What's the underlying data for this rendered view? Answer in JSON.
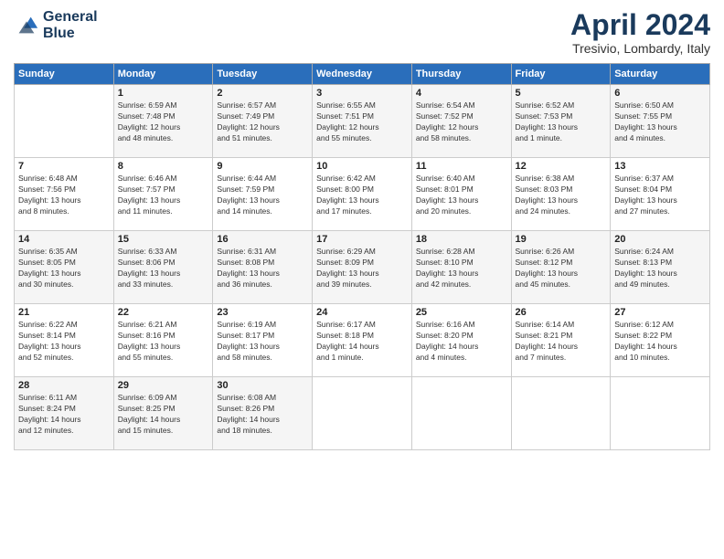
{
  "logo": {
    "line1": "General",
    "line2": "Blue"
  },
  "title": "April 2024",
  "subtitle": "Tresivio, Lombardy, Italy",
  "days_of_week": [
    "Sunday",
    "Monday",
    "Tuesday",
    "Wednesday",
    "Thursday",
    "Friday",
    "Saturday"
  ],
  "weeks": [
    [
      {
        "day": "",
        "sunrise": "",
        "sunset": "",
        "daylight": ""
      },
      {
        "day": "1",
        "sunrise": "Sunrise: 6:59 AM",
        "sunset": "Sunset: 7:48 PM",
        "daylight": "Daylight: 12 hours and 48 minutes."
      },
      {
        "day": "2",
        "sunrise": "Sunrise: 6:57 AM",
        "sunset": "Sunset: 7:49 PM",
        "daylight": "Daylight: 12 hours and 51 minutes."
      },
      {
        "day": "3",
        "sunrise": "Sunrise: 6:55 AM",
        "sunset": "Sunset: 7:51 PM",
        "daylight": "Daylight: 12 hours and 55 minutes."
      },
      {
        "day": "4",
        "sunrise": "Sunrise: 6:54 AM",
        "sunset": "Sunset: 7:52 PM",
        "daylight": "Daylight: 12 hours and 58 minutes."
      },
      {
        "day": "5",
        "sunrise": "Sunrise: 6:52 AM",
        "sunset": "Sunset: 7:53 PM",
        "daylight": "Daylight: 13 hours and 1 minute."
      },
      {
        "day": "6",
        "sunrise": "Sunrise: 6:50 AM",
        "sunset": "Sunset: 7:55 PM",
        "daylight": "Daylight: 13 hours and 4 minutes."
      }
    ],
    [
      {
        "day": "7",
        "sunrise": "Sunrise: 6:48 AM",
        "sunset": "Sunset: 7:56 PM",
        "daylight": "Daylight: 13 hours and 8 minutes."
      },
      {
        "day": "8",
        "sunrise": "Sunrise: 6:46 AM",
        "sunset": "Sunset: 7:57 PM",
        "daylight": "Daylight: 13 hours and 11 minutes."
      },
      {
        "day": "9",
        "sunrise": "Sunrise: 6:44 AM",
        "sunset": "Sunset: 7:59 PM",
        "daylight": "Daylight: 13 hours and 14 minutes."
      },
      {
        "day": "10",
        "sunrise": "Sunrise: 6:42 AM",
        "sunset": "Sunset: 8:00 PM",
        "daylight": "Daylight: 13 hours and 17 minutes."
      },
      {
        "day": "11",
        "sunrise": "Sunrise: 6:40 AM",
        "sunset": "Sunset: 8:01 PM",
        "daylight": "Daylight: 13 hours and 20 minutes."
      },
      {
        "day": "12",
        "sunrise": "Sunrise: 6:38 AM",
        "sunset": "Sunset: 8:03 PM",
        "daylight": "Daylight: 13 hours and 24 minutes."
      },
      {
        "day": "13",
        "sunrise": "Sunrise: 6:37 AM",
        "sunset": "Sunset: 8:04 PM",
        "daylight": "Daylight: 13 hours and 27 minutes."
      }
    ],
    [
      {
        "day": "14",
        "sunrise": "Sunrise: 6:35 AM",
        "sunset": "Sunset: 8:05 PM",
        "daylight": "Daylight: 13 hours and 30 minutes."
      },
      {
        "day": "15",
        "sunrise": "Sunrise: 6:33 AM",
        "sunset": "Sunset: 8:06 PM",
        "daylight": "Daylight: 13 hours and 33 minutes."
      },
      {
        "day": "16",
        "sunrise": "Sunrise: 6:31 AM",
        "sunset": "Sunset: 8:08 PM",
        "daylight": "Daylight: 13 hours and 36 minutes."
      },
      {
        "day": "17",
        "sunrise": "Sunrise: 6:29 AM",
        "sunset": "Sunset: 8:09 PM",
        "daylight": "Daylight: 13 hours and 39 minutes."
      },
      {
        "day": "18",
        "sunrise": "Sunrise: 6:28 AM",
        "sunset": "Sunset: 8:10 PM",
        "daylight": "Daylight: 13 hours and 42 minutes."
      },
      {
        "day": "19",
        "sunrise": "Sunrise: 6:26 AM",
        "sunset": "Sunset: 8:12 PM",
        "daylight": "Daylight: 13 hours and 45 minutes."
      },
      {
        "day": "20",
        "sunrise": "Sunrise: 6:24 AM",
        "sunset": "Sunset: 8:13 PM",
        "daylight": "Daylight: 13 hours and 49 minutes."
      }
    ],
    [
      {
        "day": "21",
        "sunrise": "Sunrise: 6:22 AM",
        "sunset": "Sunset: 8:14 PM",
        "daylight": "Daylight: 13 hours and 52 minutes."
      },
      {
        "day": "22",
        "sunrise": "Sunrise: 6:21 AM",
        "sunset": "Sunset: 8:16 PM",
        "daylight": "Daylight: 13 hours and 55 minutes."
      },
      {
        "day": "23",
        "sunrise": "Sunrise: 6:19 AM",
        "sunset": "Sunset: 8:17 PM",
        "daylight": "Daylight: 13 hours and 58 minutes."
      },
      {
        "day": "24",
        "sunrise": "Sunrise: 6:17 AM",
        "sunset": "Sunset: 8:18 PM",
        "daylight": "Daylight: 14 hours and 1 minute."
      },
      {
        "day": "25",
        "sunrise": "Sunrise: 6:16 AM",
        "sunset": "Sunset: 8:20 PM",
        "daylight": "Daylight: 14 hours and 4 minutes."
      },
      {
        "day": "26",
        "sunrise": "Sunrise: 6:14 AM",
        "sunset": "Sunset: 8:21 PM",
        "daylight": "Daylight: 14 hours and 7 minutes."
      },
      {
        "day": "27",
        "sunrise": "Sunrise: 6:12 AM",
        "sunset": "Sunset: 8:22 PM",
        "daylight": "Daylight: 14 hours and 10 minutes."
      }
    ],
    [
      {
        "day": "28",
        "sunrise": "Sunrise: 6:11 AM",
        "sunset": "Sunset: 8:24 PM",
        "daylight": "Daylight: 14 hours and 12 minutes."
      },
      {
        "day": "29",
        "sunrise": "Sunrise: 6:09 AM",
        "sunset": "Sunset: 8:25 PM",
        "daylight": "Daylight: 14 hours and 15 minutes."
      },
      {
        "day": "30",
        "sunrise": "Sunrise: 6:08 AM",
        "sunset": "Sunset: 8:26 PM",
        "daylight": "Daylight: 14 hours and 18 minutes."
      },
      {
        "day": "",
        "sunrise": "",
        "sunset": "",
        "daylight": ""
      },
      {
        "day": "",
        "sunrise": "",
        "sunset": "",
        "daylight": ""
      },
      {
        "day": "",
        "sunrise": "",
        "sunset": "",
        "daylight": ""
      },
      {
        "day": "",
        "sunrise": "",
        "sunset": "",
        "daylight": ""
      }
    ]
  ]
}
